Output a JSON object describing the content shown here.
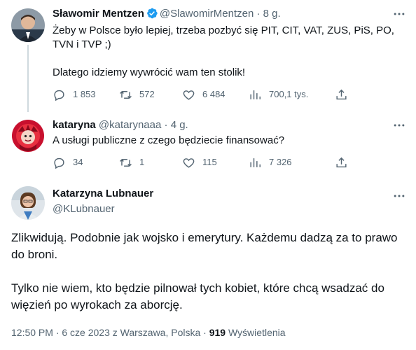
{
  "tweets": [
    {
      "name": "Sławomir Mentzen",
      "handle": "@SlawomirMentzen",
      "sep": "·",
      "time": "8 g.",
      "verified": true,
      "text_line1": "Żeby w Polsce było lepiej, trzeba pozbyć się PIT, CIT, VAT, ZUS, PiS, PO,",
      "text_line2": "TVN i TVP  ;)",
      "text_line3": "Dlatego idziemy wywrócić wam ten stolik!",
      "replies": "1 853",
      "retweets": "572",
      "likes": "6 484",
      "views": "700,1 tys."
    },
    {
      "name": "kataryna",
      "handle": "@katarynaaa",
      "sep": "·",
      "time": "4 g.",
      "text_line1": "A usługi publiczne z czego będziecie finansować?",
      "replies": "34",
      "retweets": "1",
      "likes": "115",
      "views": "7 326"
    }
  ],
  "main": {
    "name": "Katarzyna Lubnauer",
    "handle": "@KLubnauer",
    "para1": "Zlikwidują. Podobnie jak wojsko i emerytury. Każdemu dadzą za to prawo do broni.",
    "para2": "Tylko nie wiem, kto będzie pilnował tych kobiet, które chcą wsadzać do więzień po wyrokach za aborcję.",
    "meta_time": "12:50 PM · 6 cze 2023 z Warszawa, Polska · ",
    "meta_views": "919",
    "meta_views_label": " Wyświetlenia"
  },
  "colors": {
    "text": "#0f1419",
    "secondary": "#536471",
    "verified": "#1d9bf0",
    "thread_line": "#cfd9de"
  },
  "icons": [
    "reply-icon",
    "retweet-icon",
    "like-icon",
    "views-icon",
    "share-icon",
    "more-icon",
    "verified-badge-icon"
  ]
}
